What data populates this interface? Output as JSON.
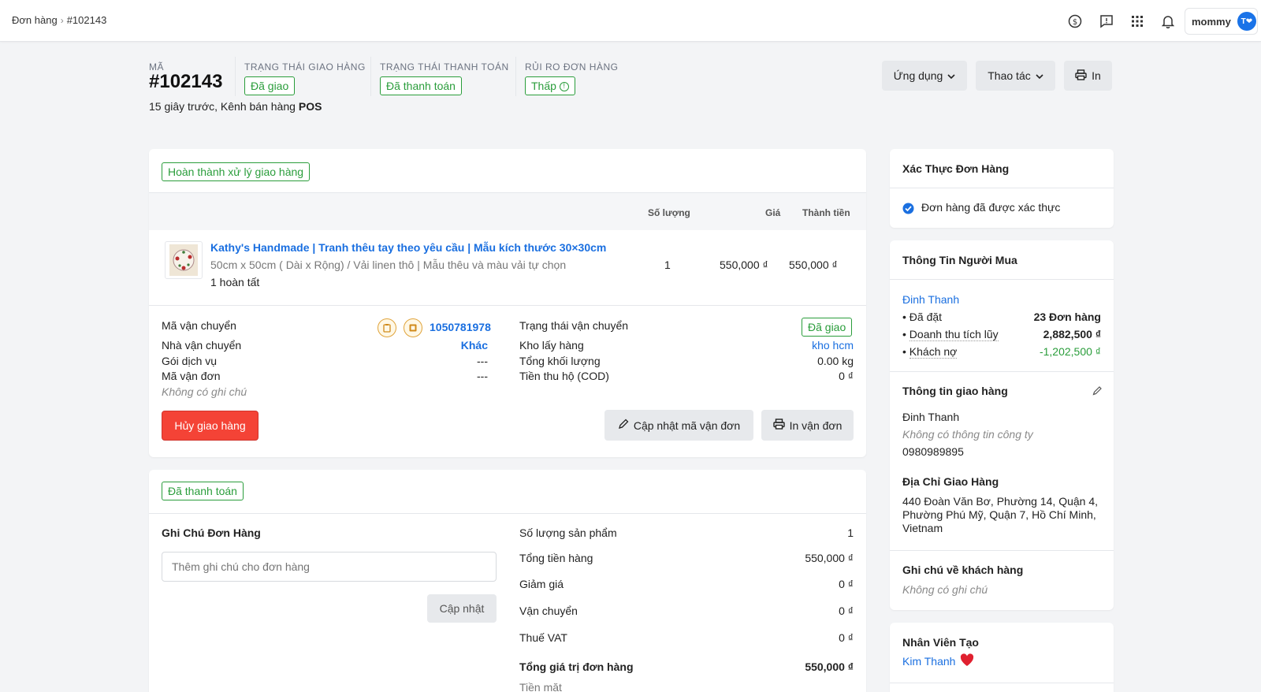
{
  "breadcrumb": {
    "parent": "Đơn hàng",
    "current": "#102143"
  },
  "user": {
    "name": "mommy",
    "avatar_initials": "T❤"
  },
  "topbar_icons": [
    "dollar-icon",
    "feedback-icon",
    "apps-grid-icon",
    "bell-icon"
  ],
  "order": {
    "code_label": "MÃ",
    "code": "#102143",
    "meta_text": "15 giây trước, Kênh bán hàng",
    "channel": "POS",
    "delivery_status_label": "TRẠNG THÁI GIAO HÀNG",
    "delivery_status": "Đã giao",
    "payment_status_label": "TRẠNG THÁI THANH TOÁN",
    "payment_status": "Đã thanh toán",
    "risk_label": "RỦI RO ĐƠN HÀNG",
    "risk": "Thấp"
  },
  "actions": {
    "apps": "Ứng dụng",
    "operations": "Thao tác",
    "print": "In"
  },
  "fulfillment": {
    "badge": "Hoàn thành xử lý giao hàng",
    "col_qty": "Số lượng",
    "col_price": "Giá",
    "col_total": "Thành tiền",
    "item": {
      "name": "Kathy's Handmade | Tranh thêu tay theo yêu cầu | Mẫu kích thước 30×30cm",
      "variant": "50cm x 50cm ( Dài x Rộng) / Vải linen thô | Mẫu thêu và màu vải tự chọn",
      "status": "1 hoàn tất",
      "qty": "1",
      "price": "550,000 ₫",
      "total": "550,000 ₫"
    },
    "shipping": {
      "tracking_code_label": "Mã vận chuyển",
      "tracking_code": "1050781978",
      "carrier_label": "Nhà vận chuyển",
      "carrier": "Khác",
      "service_label": "Gói dịch vụ",
      "service": "---",
      "waybill_label": "Mã vận đơn",
      "waybill": "---",
      "note": "Không có ghi chú",
      "ship_status_label": "Trạng thái vận chuyển",
      "ship_status": "Đã giao",
      "warehouse_label": "Kho lấy hàng",
      "warehouse": "kho hcm",
      "weight_label": "Tổng khối lượng",
      "weight": "0.00 kg",
      "cod_label": "Tiền thu hộ (COD)",
      "cod": "0 ₫"
    },
    "cancel_button": "Hủy giao hàng",
    "update_waybill_button": "Cập nhật mã vận đơn",
    "print_waybill_button": "In vận đơn"
  },
  "payment": {
    "badge": "Đã thanh toán",
    "note_title": "Ghi Chú Đơn Hàng",
    "note_placeholder": "Thêm ghi chú cho đơn hàng",
    "update_button": "Cập nhật",
    "rows": [
      {
        "label": "Số lượng sản phẩm",
        "value": "1"
      },
      {
        "label": "Tổng tiền hàng",
        "value": "550,000 ₫"
      },
      {
        "label": "Giảm giá",
        "value": "0 ₫"
      },
      {
        "label": "Vận chuyển",
        "value": "0 ₫"
      },
      {
        "label": "Thuế VAT",
        "value": "0 ₫"
      }
    ],
    "grand_total_label": "Tổng giá trị đơn hàng",
    "grand_total": "550,000 ₫",
    "cash_label": "Tiền mặt"
  },
  "verify": {
    "title": "Xác Thực Đơn Hàng",
    "text": "Đơn hàng đã được xác thực"
  },
  "buyer": {
    "title": "Thông Tin Người Mua",
    "name": "Đinh Thanh",
    "orders_label": "• Đã đặt",
    "orders_value": "23 Đơn hàng",
    "revenue_label": "Doanh thu tích lũy",
    "revenue_value": "2,882,500 ₫",
    "debt_label": "Khách nợ",
    "debt_value": "-1,202,500 ₫",
    "bullet": "•"
  },
  "shipping_info": {
    "title": "Thông tin giao hàng",
    "name": "Đinh Thanh",
    "company": "Không có thông tin công ty",
    "phone": "0980989895",
    "address_title": "Địa Chỉ Giao Hàng",
    "address": "440 Đoàn Văn Bơ, Phường 14, Quận 4, Phường Phú Mỹ, Quận 7, Hồ Chí Minh, Vietnam"
  },
  "customer_note": {
    "title": "Ghi chú về khách hàng",
    "text": "Không có ghi chú"
  },
  "staff": {
    "title": "Nhân Viên Tạo",
    "name": "Kim Thanh"
  },
  "colors": {
    "green": "#2a9d3b",
    "blue": "#1a6fe0",
    "red": "#f44336"
  }
}
